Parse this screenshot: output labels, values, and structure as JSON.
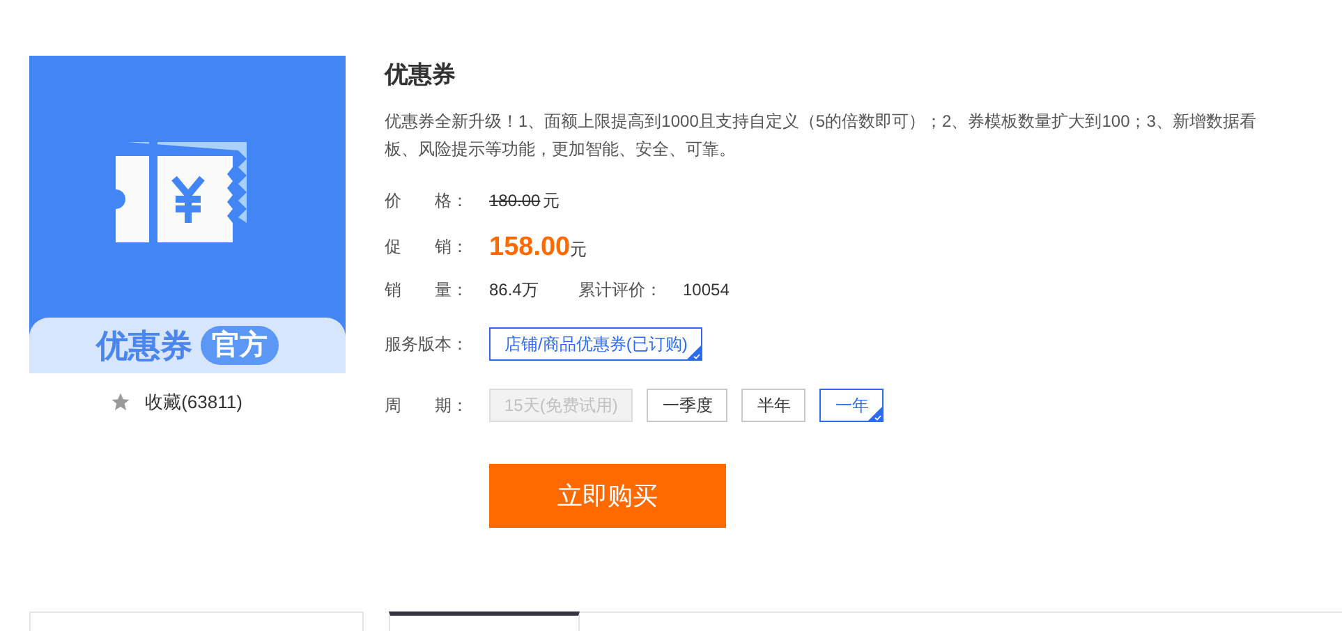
{
  "product_image": {
    "banner_text": "优惠券",
    "badge": "官方"
  },
  "favorite": {
    "label": "收藏(63811)"
  },
  "title": "优惠券",
  "description": "优惠券全新升级！1、面额上限提高到1000且支持自定义（5的倍数即可）；2、券模板数量扩大到100；3、新增数据看板、风险提示等功能，更加智能、安全、可靠。",
  "price": {
    "label": "价　　格：",
    "value": "180.00",
    "unit": "元"
  },
  "promo": {
    "label": "促　　销：",
    "value": "158.00",
    "unit": "元"
  },
  "sales": {
    "label": "销　　量：",
    "value": "86.4万",
    "reviews_label": "累计评价：",
    "reviews_value": "10054"
  },
  "version": {
    "label": "服务版本：",
    "options": [
      {
        "label": "店铺/商品优惠券(已订购)",
        "selected": true
      }
    ]
  },
  "period": {
    "label": "周　　期：",
    "options": [
      {
        "label": "15天(免费试用)",
        "selected": false,
        "disabled": true
      },
      {
        "label": "一季度",
        "selected": false,
        "disabled": false
      },
      {
        "label": "半年",
        "selected": false,
        "disabled": false
      },
      {
        "label": "一年",
        "selected": true,
        "disabled": false
      }
    ]
  },
  "buy_button": "立即购买"
}
